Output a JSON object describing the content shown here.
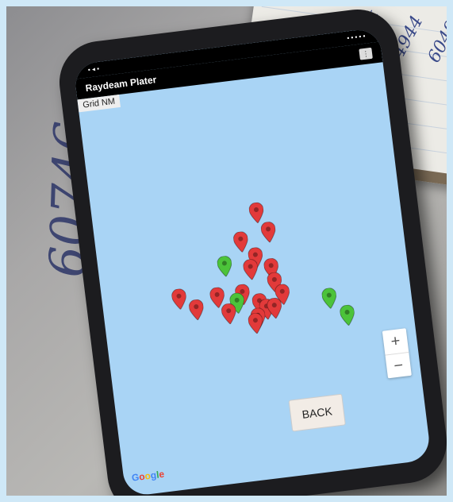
{
  "app": {
    "title": "Raydeam Plater"
  },
  "map": {
    "grid_label": "Grid NM",
    "overflow_icon": "menu-icon",
    "zoom_in_label": "+",
    "zoom_out_label": "−",
    "back_label": "BACK",
    "attribution": "Google",
    "marker_colors": {
      "red": "#e23a3a",
      "green": "#4cc33a"
    }
  },
  "markers": [
    {
      "color": "red"
    },
    {
      "color": "red"
    },
    {
      "color": "red"
    },
    {
      "color": "red"
    },
    {
      "color": "green"
    },
    {
      "color": "red"
    },
    {
      "color": "red"
    },
    {
      "color": "red"
    },
    {
      "color": "red"
    },
    {
      "color": "red"
    },
    {
      "color": "red"
    },
    {
      "color": "red"
    },
    {
      "color": "green"
    },
    {
      "color": "red"
    },
    {
      "color": "red"
    },
    {
      "color": "red"
    },
    {
      "color": "red"
    },
    {
      "color": "red"
    },
    {
      "color": "red"
    },
    {
      "color": "red"
    },
    {
      "color": "green"
    },
    {
      "color": "green"
    }
  ],
  "desk": {
    "writing": "60746"
  }
}
